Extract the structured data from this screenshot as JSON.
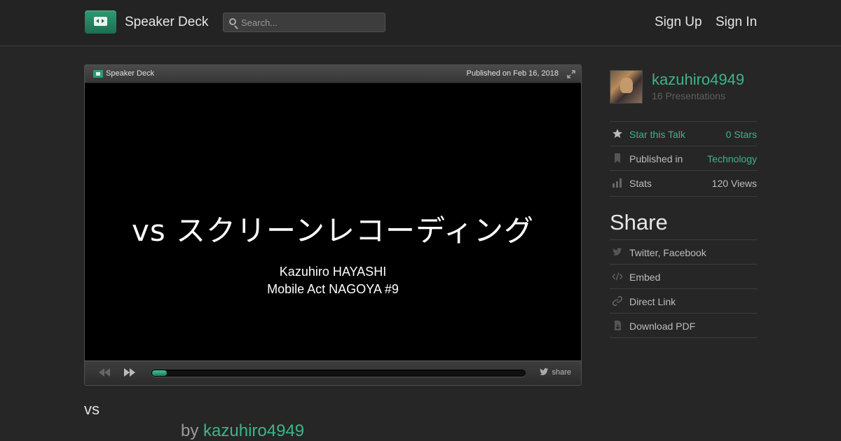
{
  "header": {
    "brand": "Speaker Deck",
    "search_placeholder": "Search...",
    "sign_up": "Sign Up",
    "sign_in": "Sign In"
  },
  "player": {
    "brand": "Speaker Deck",
    "published": "Published on Feb 16, 2018",
    "slide": {
      "title": "vs スクリーンレコーディング",
      "author": "Kazuhiro HAYASHI",
      "event": "Mobile Act NAGOYA #9"
    },
    "share_label": "share",
    "progress_fraction": 0.04
  },
  "talk": {
    "title": "vs",
    "by_prefix": "by",
    "author": "kazuhiro4949"
  },
  "sidebar": {
    "user": "kazuhiro4949",
    "presentations": "16 Presentations",
    "star_label": "Star this Talk",
    "stars": "0 Stars",
    "published_label": "Published in",
    "category": "Technology",
    "stats_label": "Stats",
    "views": "120 Views",
    "share_heading": "Share",
    "share_items": [
      "Twitter, Facebook",
      "Embed",
      "Direct Link",
      "Download PDF"
    ]
  },
  "colors": {
    "accent": "#3eb489",
    "background": "#262626",
    "header": "#232323"
  },
  "icons": [
    "search-icon",
    "expand-icon",
    "rewind-icon",
    "fast-forward-icon",
    "twitter-icon",
    "star-icon",
    "bookmark-icon",
    "stats-icon",
    "embed-icon",
    "link-icon",
    "download-icon"
  ]
}
